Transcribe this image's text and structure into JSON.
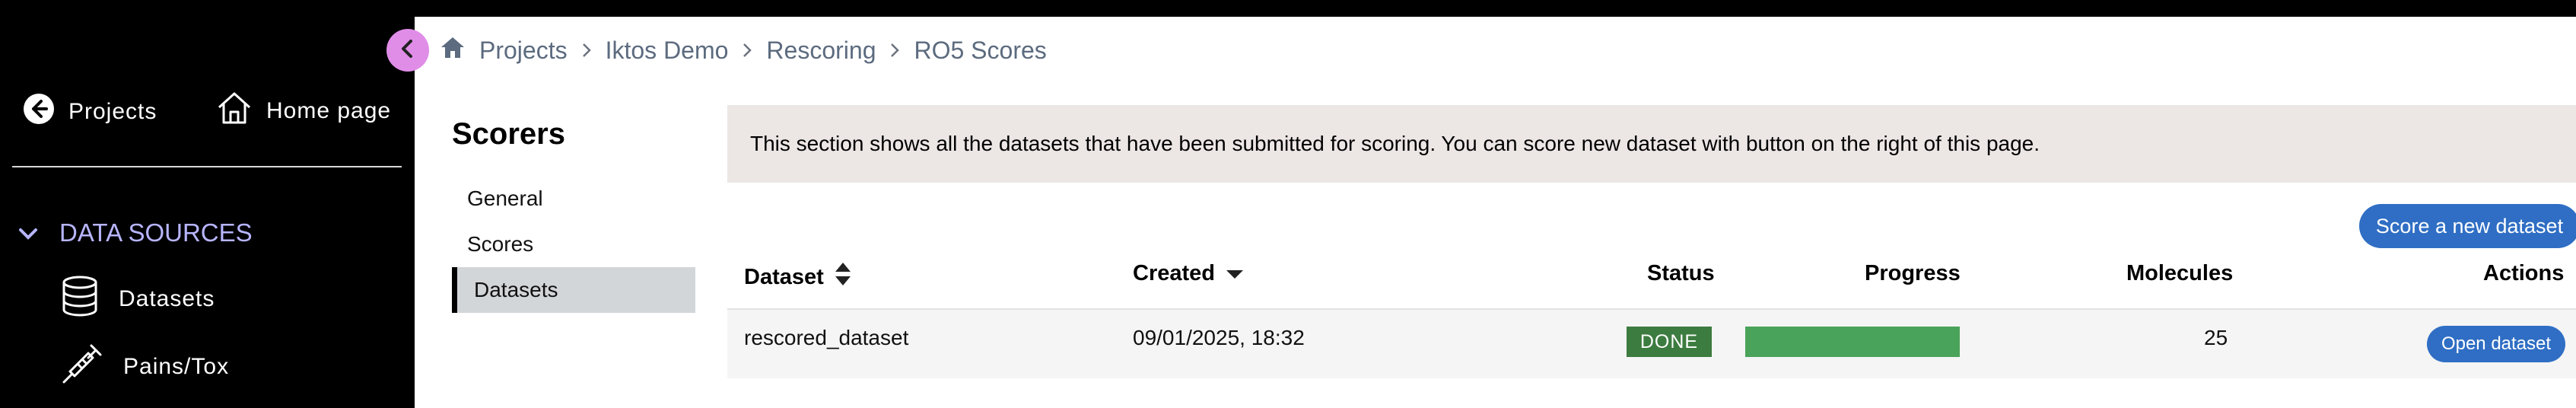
{
  "sidebar": {
    "projects_label": "Projects",
    "home_label": "Home page",
    "section_title": "DATA SOURCES",
    "items": [
      {
        "label": "Datasets",
        "icon": "database-icon"
      },
      {
        "label": "Pains/Tox",
        "icon": "syringe-icon"
      }
    ]
  },
  "breadcrumb": [
    "Projects",
    "Iktos Demo",
    "Rescoring",
    "RO5 Scores"
  ],
  "scorers": {
    "title": "Scorers",
    "menu": [
      {
        "label": "General"
      },
      {
        "label": "Scores"
      },
      {
        "label": "Datasets",
        "active": true
      }
    ]
  },
  "info_banner": "This section shows all the datasets that have been submitted for scoring. You can score new dataset with button on the right of this page.",
  "score_button_label": "Score a new dataset",
  "table": {
    "headers": {
      "dataset": "Dataset",
      "created": "Created",
      "status": "Status",
      "progress": "Progress",
      "molecules": "Molecules",
      "actions": "Actions"
    },
    "rows": [
      {
        "dataset": "rescored_dataset",
        "created": "09/01/2025, 18:32",
        "status": "DONE",
        "progress": 1.0,
        "molecules": "25",
        "action_label": "Open dataset"
      }
    ]
  },
  "colors": {
    "sidebar_bg": "#000000",
    "section_accent": "#b7b5ff",
    "collapse_button": "#e08de8",
    "primary_button": "#2f6ec4",
    "status_done": "#3d7c40",
    "progress_fill": "#4aa35a",
    "banner_bg": "#ece6e5"
  }
}
